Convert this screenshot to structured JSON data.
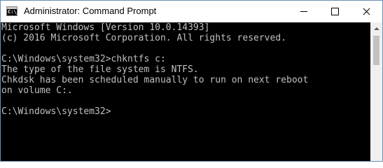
{
  "window": {
    "title": "Administrator: Command Prompt",
    "app_icon_text": "C:\\_",
    "controls": {
      "minimize": "minimize-icon",
      "maximize": "maximize-icon",
      "close": "close-icon"
    }
  },
  "console": {
    "text_color": "#c0c0c0",
    "background_color": "#000000",
    "lines": [
      "Microsoft Windows [Version 10.0.14393]",
      "(c) 2016 Microsoft Corporation. All rights reserved.",
      "",
      "C:\\Windows\\system32>chkntfs c:",
      "The type of the file system is NTFS.",
      "Chkdsk has been scheduled manually to run on next reboot",
      "on volume C:.",
      "",
      "C:\\Windows\\system32>"
    ]
  }
}
